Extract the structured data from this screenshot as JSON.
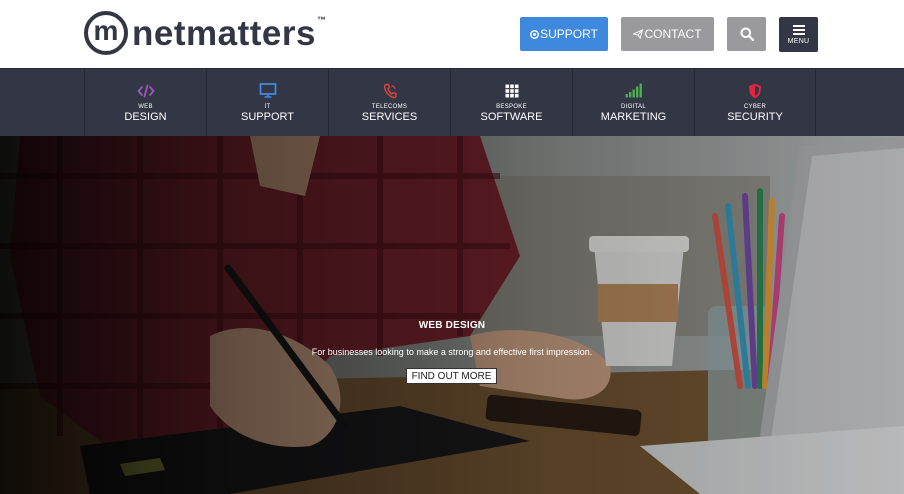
{
  "brand": {
    "logo_letter": "m",
    "name": "netmatters",
    "trademark": "™"
  },
  "header": {
    "support_label": "SUPPORT",
    "contact_label": "CONTACT",
    "menu_label": "MENU"
  },
  "nav": {
    "items": [
      {
        "small": "WEB",
        "big": "DESIGN",
        "icon": "code-icon",
        "color": "#9b59b6"
      },
      {
        "small": "IT",
        "big": "SUPPORT",
        "icon": "monitor-icon",
        "color": "#3e88de"
      },
      {
        "small": "TELECOMS",
        "big": "SERVICES",
        "icon": "phone-icon",
        "color": "#d64541"
      },
      {
        "small": "BESPOKE",
        "big": "SOFTWARE",
        "icon": "grid-icon",
        "color": "#ffffff"
      },
      {
        "small": "DIGITAL",
        "big": "MARKETING",
        "icon": "signal-bars-icon",
        "color": "#4caf50"
      },
      {
        "small": "CYBER",
        "big": "SECURITY",
        "icon": "shield-icon",
        "color": "#e0273f"
      }
    ]
  },
  "hero": {
    "title": "WEB DESIGN",
    "subtitle": "For businesses looking to make a strong and effective first impression.",
    "button_label": "FIND OUT MORE"
  },
  "colors": {
    "brand_dark": "#333645",
    "support_blue": "#3e88de",
    "grey_button": "#9a9a9e"
  }
}
